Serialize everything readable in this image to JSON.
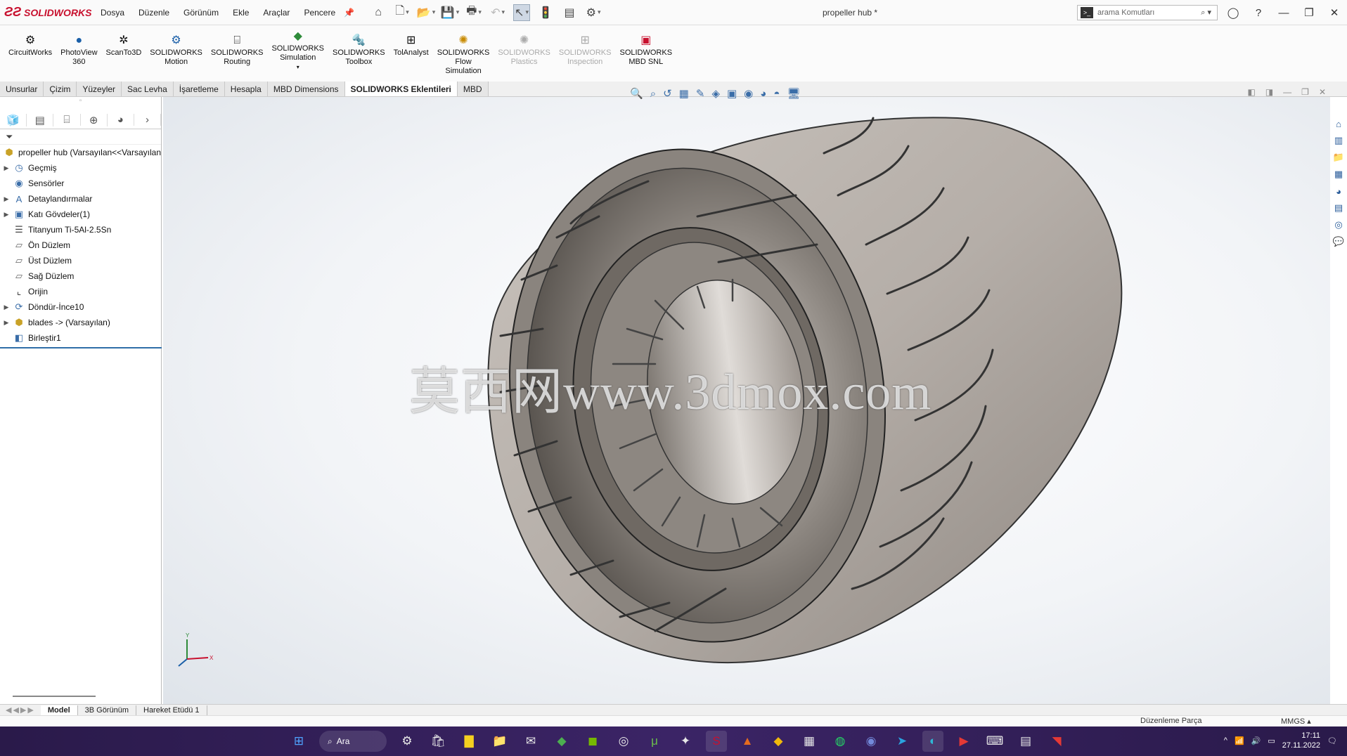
{
  "app": {
    "brand": "SOLIDWORKS",
    "document_title": "propeller hub *"
  },
  "menu": [
    "Dosya",
    "Düzenle",
    "Görünüm",
    "Ekle",
    "Araçlar",
    "Pencere"
  ],
  "search": {
    "placeholder": "arama Komutları"
  },
  "ribbon": [
    {
      "label": "CircuitWorks",
      "icon": "circuitworks-icon",
      "enabled": true
    },
    {
      "label": "PhotoView\n360",
      "icon": "photoview-icon",
      "enabled": true
    },
    {
      "label": "ScanTo3D",
      "icon": "scanto3d-icon",
      "enabled": true
    },
    {
      "label": "SOLIDWORKS\nMotion",
      "icon": "motion-icon",
      "enabled": true
    },
    {
      "label": "SOLIDWORKS\nRouting",
      "icon": "routing-icon",
      "enabled": true
    },
    {
      "label": "SOLIDWORKS\nSimulation",
      "icon": "simulation-icon",
      "enabled": true
    },
    {
      "label": "SOLIDWORKS\nToolbox",
      "icon": "toolbox-icon",
      "enabled": true
    },
    {
      "label": "TolAnalyst",
      "icon": "tolanalyst-icon",
      "enabled": true
    },
    {
      "label": "SOLIDWORKS\nFlow\nSimulation",
      "icon": "flow-simulation-icon",
      "enabled": true
    },
    {
      "label": "SOLIDWORKS\nPlastics",
      "icon": "plastics-icon",
      "enabled": false
    },
    {
      "label": "SOLIDWORKS\nInspection",
      "icon": "inspection-icon",
      "enabled": false
    },
    {
      "label": "SOLIDWORKS\nMBD SNL",
      "icon": "mbd-snl-icon",
      "enabled": true
    }
  ],
  "tabs": [
    "Unsurlar",
    "Çizim",
    "Yüzeyler",
    "Sac Levha",
    "İşaretleme",
    "Hesapla",
    "MBD Dimensions",
    "SOLIDWORKS Eklentileri",
    "MBD"
  ],
  "active_tab": "SOLIDWORKS Eklentileri",
  "feature_tree": {
    "root": "propeller hub  (Varsayılan<<Varsayılan",
    "items": [
      {
        "label": "Geçmiş",
        "icon": "history-icon",
        "expandable": true
      },
      {
        "label": "Sensörler",
        "icon": "sensor-icon",
        "expandable": false
      },
      {
        "label": "Detaylandırmalar",
        "icon": "annotations-icon",
        "expandable": true
      },
      {
        "label": "Katı Gövdeler(1)",
        "icon": "solid-bodies-icon",
        "expandable": true
      },
      {
        "label": "Titanyum Ti-5Al-2.5Sn",
        "icon": "material-icon",
        "expandable": false
      },
      {
        "label": "Ön Düzlem",
        "icon": "plane-icon",
        "expandable": false
      },
      {
        "label": "Üst Düzlem",
        "icon": "plane-icon",
        "expandable": false
      },
      {
        "label": "Sağ Düzlem",
        "icon": "plane-icon",
        "expandable": false
      },
      {
        "label": "Orijin",
        "icon": "origin-icon",
        "expandable": false
      },
      {
        "label": "Döndür-İnce10",
        "icon": "revolve-icon",
        "expandable": true
      },
      {
        "label": "blades -> (Varsayılan)",
        "icon": "part-icon",
        "expandable": true
      },
      {
        "label": "Birleştir1",
        "icon": "combine-icon",
        "expandable": false
      }
    ]
  },
  "model_tabs": [
    "Model",
    "3B Görünüm",
    "Hareket Etüdü 1"
  ],
  "status": {
    "mode": "Düzenleme Parça",
    "units": "MMGS"
  },
  "watermark": "莫西网www.3dmox.com",
  "taskbar": {
    "search_label": "Ara",
    "time": "17:11",
    "date": "27.11.2022"
  },
  "colors": {
    "brand": "#c8102e",
    "selection_bar": "#2f6ea8",
    "taskbar": "#2a1a4a",
    "model_body": "#b5aea8"
  }
}
